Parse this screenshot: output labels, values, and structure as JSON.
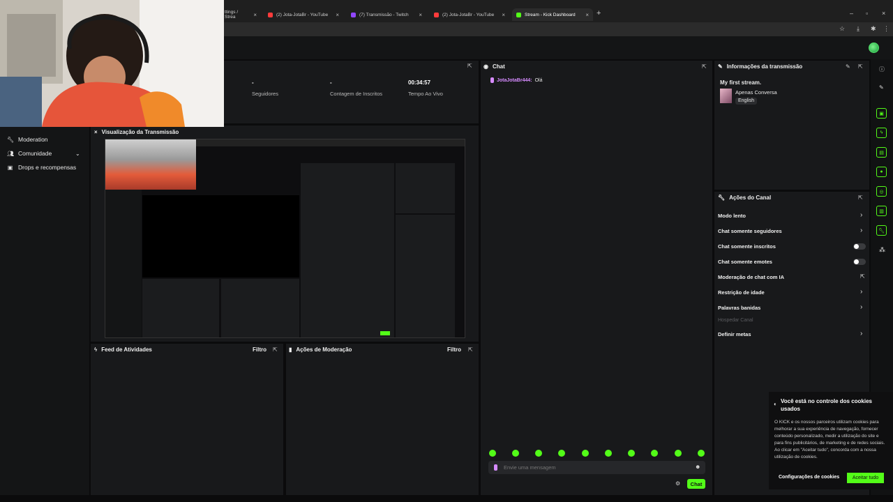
{
  "browser": {
    "tabs": [
      {
        "label": "ttings / Strea",
        "color": "#53fc18"
      },
      {
        "label": "(2) Jota-JotaBr - YouTube",
        "color": "#ff3b3b"
      },
      {
        "label": "(7) Transmissão - Twitch",
        "color": "#9146ff"
      },
      {
        "label": "(2) Jota-JotaBr - YouTube",
        "color": "#ff3b3b"
      },
      {
        "label": "Stream - Kick Dashboard",
        "color": "#53fc18"
      }
    ]
  },
  "sidebar": {
    "items": [
      {
        "label": "Moderation"
      },
      {
        "label": "Comunidade"
      },
      {
        "label": "Drops e recompensas"
      }
    ]
  },
  "stats": [
    {
      "value": "-",
      "label": "Seguidores"
    },
    {
      "value": "-",
      "label": "Contagem de Inscritos"
    },
    {
      "value": "00:34:57",
      "label": "Tempo Ao Vivo"
    }
  ],
  "preview": {
    "title": "Visualização da Transmissão"
  },
  "feed": {
    "title": "Feed de Atividades",
    "filter": "Filtro"
  },
  "modactions": {
    "title": "Ações de Moderação",
    "filter": "Filtro"
  },
  "chat": {
    "title": "Chat",
    "message": {
      "user": "JotaJotaBr444:",
      "text": "Olá"
    },
    "input_placeholder": "Envie uma mensagem",
    "send_label": "Chat"
  },
  "stream_info": {
    "title": "Informações da transmissão",
    "stream_title": "My first stream.",
    "category": "Apenas Conversa",
    "language": "English"
  },
  "channel_actions": {
    "title": "Ações do Canal",
    "items": [
      {
        "label": "Modo lento"
      },
      {
        "label": "Chat somente seguidores"
      },
      {
        "label": "Chat somente inscritos"
      },
      {
        "label": "Chat somente emotes"
      },
      {
        "label": "Moderação de chat com IA"
      },
      {
        "label": "Restrição de idade"
      },
      {
        "label": "Palavras banidas"
      },
      {
        "label": "Hospedar Canal"
      },
      {
        "label": "Definir metas"
      }
    ]
  },
  "cookie": {
    "title": "Você está no controle dos cookies usados",
    "text": "O KICK e os nossos parceiros utilizam cookies para melhorar a sua experiência de navegação, fornecer conteúdo personalizado, medir a utilização do site e para fins publicitários, de marketing e de redes sociais. Ao clicar em \"Aceitar tudo\", concorda com a nossa utilização de cookies.",
    "settings_label": "Configurações de cookies",
    "accept_label": "Aceitar tudo"
  },
  "colors": {
    "accent": "#53fc18",
    "chat_user": "#d68bff"
  }
}
